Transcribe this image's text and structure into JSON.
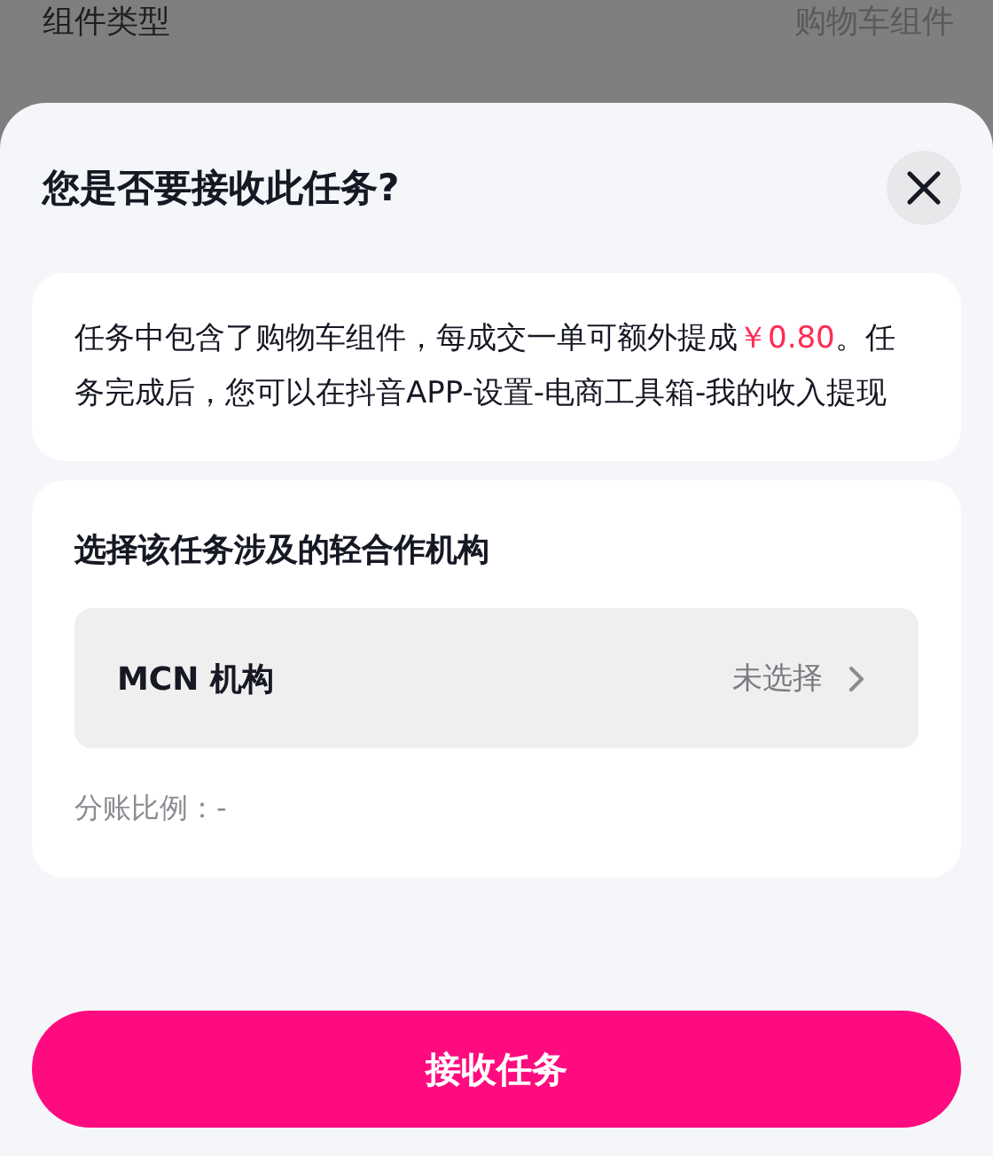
{
  "background_row": {
    "label": "组件类型",
    "value": "购物车组件"
  },
  "sheet": {
    "title": "您是否要接收此任务?",
    "description": [
      {
        "kind": "normal",
        "text": "任务中包含了购物车组件，每成交一单可额外提成"
      },
      {
        "kind": "price",
        "text": "￥0.80"
      },
      {
        "kind": "normal",
        "text": "。任务完成后，您可以在抖音APP-设置-电商工具箱-我的收入提现"
      }
    ],
    "organization": {
      "heading": "选择该任务涉及的轻合作机构",
      "selector_label": "MCN 机构",
      "selector_value": "未选择",
      "ratio": "分账比例：-"
    },
    "confirm_button": "接收任务"
  }
}
